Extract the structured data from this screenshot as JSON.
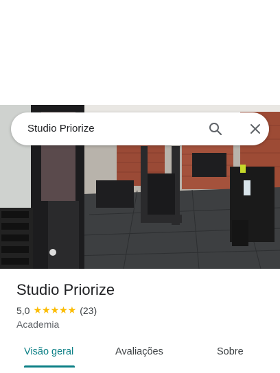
{
  "search": {
    "query": "Studio Priorize"
  },
  "place": {
    "name": "Studio Priorize",
    "rating": "5,0",
    "stars": "★★★★★",
    "reviews": "(23)",
    "category": "Academia"
  },
  "tabs": [
    {
      "label": "Visão geral",
      "active": true
    },
    {
      "label": "Avaliações"
    },
    {
      "label": "Sobre"
    }
  ],
  "colors": {
    "accent": "#0b7f85",
    "star": "#fbbc04"
  }
}
